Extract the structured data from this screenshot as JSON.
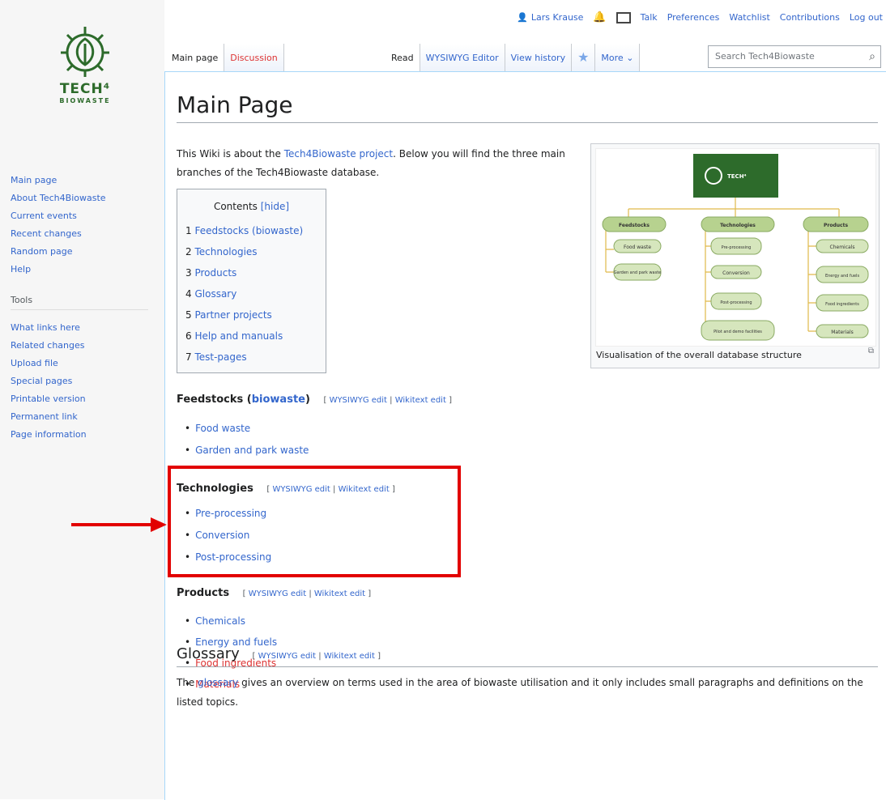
{
  "logo": {
    "text": "TECH⁴",
    "subtext": "BIOWASTE"
  },
  "sidebar": {
    "nav": [
      "Main page",
      "About Tech4Biowaste",
      "Current events",
      "Recent changes",
      "Random page",
      "Help"
    ],
    "tools_heading": "Tools",
    "tools": [
      "What links here",
      "Related changes",
      "Upload file",
      "Special pages",
      "Printable version",
      "Permanent link",
      "Page information"
    ]
  },
  "personal": {
    "user": "Lars Krause",
    "links": [
      "Talk",
      "Preferences",
      "Watchlist",
      "Contributions",
      "Log out"
    ]
  },
  "tabs": {
    "left": [
      "Main page",
      "Discussion"
    ],
    "right": [
      "Read",
      "WYSIWYG Editor",
      "View history"
    ],
    "more": "More"
  },
  "search": {
    "placeholder": "Search Tech4Biowaste"
  },
  "page": {
    "title": "Main Page",
    "intro_1": "This Wiki is about the ",
    "intro_link": "Tech4Biowaste project",
    "intro_2": ". Below you will find the three main branches of the Tech4Biowaste database."
  },
  "toc": {
    "title": "Contents",
    "hide": "[hide]",
    "items": [
      {
        "num": "1",
        "label": "Feedstocks (biowaste)"
      },
      {
        "num": "2",
        "label": "Technologies"
      },
      {
        "num": "3",
        "label": "Products"
      },
      {
        "num": "4",
        "label": "Glossary"
      },
      {
        "num": "5",
        "label": "Partner projects"
      },
      {
        "num": "6",
        "label": "Help and manuals"
      },
      {
        "num": "7",
        "label": "Test-pages"
      }
    ]
  },
  "thumb": {
    "caption": "Visualisation of the overall database structure",
    "header_text": "TECH⁴",
    "columns": [
      {
        "head": "Feedstocks",
        "items": [
          "Food waste",
          "Garden and park waste"
        ]
      },
      {
        "head": "Technologies",
        "items": [
          "Pre-processing",
          "Conversion",
          "Post-processing",
          "Pilot and demo facilities"
        ]
      },
      {
        "head": "Products",
        "items": [
          "Chemicals",
          "Energy and fuels",
          "Food ingredients",
          "Materials"
        ]
      }
    ]
  },
  "edit": {
    "wysiwyg": "WYSIWYG edit",
    "wikitext": "Wikitext edit",
    "sep": "|",
    "open": "[",
    "close": "]"
  },
  "sections": {
    "feedstocks": {
      "title_1": "Feedstocks (",
      "title_link": "biowaste",
      "title_2": ")",
      "items": [
        "Food waste",
        "Garden and park waste"
      ]
    },
    "technologies": {
      "title": "Technologies",
      "items": [
        "Pre-processing",
        "Conversion",
        "Post-processing"
      ]
    },
    "products": {
      "title": "Products",
      "items": [
        "Chemicals",
        "Energy and fuels",
        "Food ingredients",
        "Materials"
      ]
    },
    "glossary": {
      "title": "Glossary",
      "text_1": "The ",
      "text_link": "glossary",
      "text_2": " gives an overview on terms used in the area of biowaste utilisation and it only includes small paragraphs and definitions on the listed topics."
    }
  },
  "colors": {
    "link": "#3366cc",
    "redlink": "#d33",
    "highlight": "#e20000",
    "brand": "#2d6b2b",
    "node": "#b7d28f"
  }
}
